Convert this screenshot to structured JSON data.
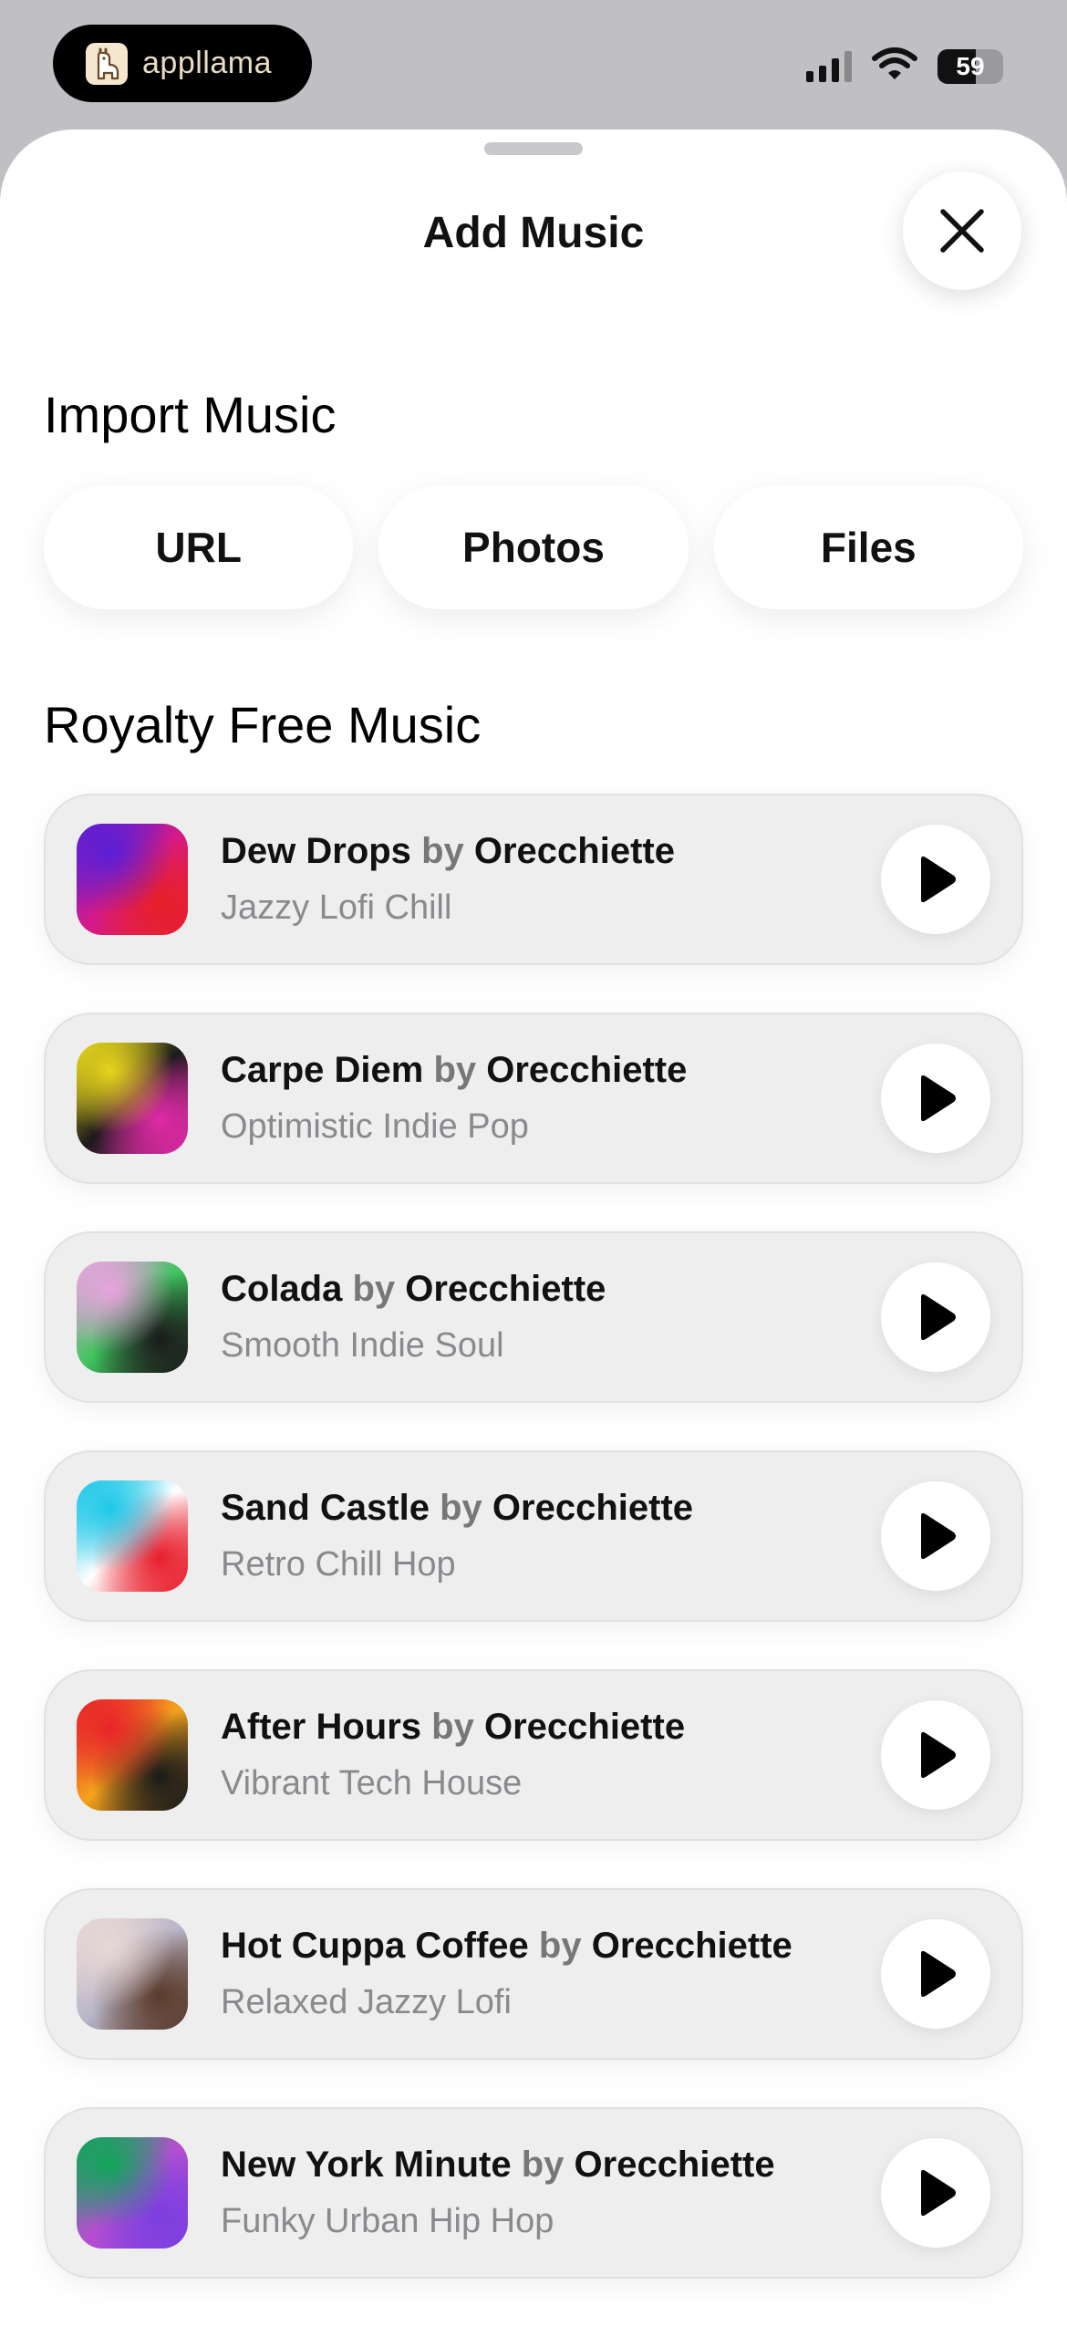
{
  "status": {
    "app_name": "appllama",
    "battery_level": "59"
  },
  "sheet": {
    "title": "Add Music"
  },
  "import": {
    "heading": "Import Music",
    "buttons": [
      "URL",
      "Photos",
      "Files"
    ]
  },
  "royalty": {
    "heading": "Royalty Free Music",
    "tracks": [
      {
        "title": "Dew Drops",
        "by": "by",
        "artist": "Orecchiette",
        "genre": "Jazzy Lofi Chill",
        "art": [
          "#5a1fd6",
          "#d41a8a",
          "#e8202a"
        ]
      },
      {
        "title": "Carpe Diem",
        "by": "by",
        "artist": "Orecchiette",
        "genre": "Optimistic Indie Pop",
        "art": [
          "#e6d41d",
          "#1a1a1a",
          "#e02aa6"
        ]
      },
      {
        "title": "Colada",
        "by": "by",
        "artist": "Orecchiette",
        "genre": "Smooth Indie Soul",
        "art": [
          "#e9a3df",
          "#3fc45e",
          "#1b1b1b"
        ]
      },
      {
        "title": "Sand Castle",
        "by": "by",
        "artist": "Orecchiette",
        "genre": "Retro Chill Hop",
        "art": [
          "#1ec8e8",
          "#ffffff",
          "#e81f2c"
        ]
      },
      {
        "title": "After Hours",
        "by": "by",
        "artist": "Orecchiette",
        "genre": "Vibrant Tech House",
        "art": [
          "#e8242a",
          "#f4a21c",
          "#1a1a1a"
        ]
      },
      {
        "title": "Hot Cuppa Coffee",
        "by": "by",
        "artist": "Orecchiette",
        "genre": "Relaxed Jazzy Lofi",
        "art": [
          "#e7d7d6",
          "#b9b6c8",
          "#5b3b2c"
        ]
      },
      {
        "title": "New York Minute",
        "by": "by",
        "artist": "Orecchiette",
        "genre": "Funky Urban Hip Hop",
        "art": [
          "#12a65a",
          "#b64fd0",
          "#7c3fe0"
        ]
      }
    ]
  }
}
